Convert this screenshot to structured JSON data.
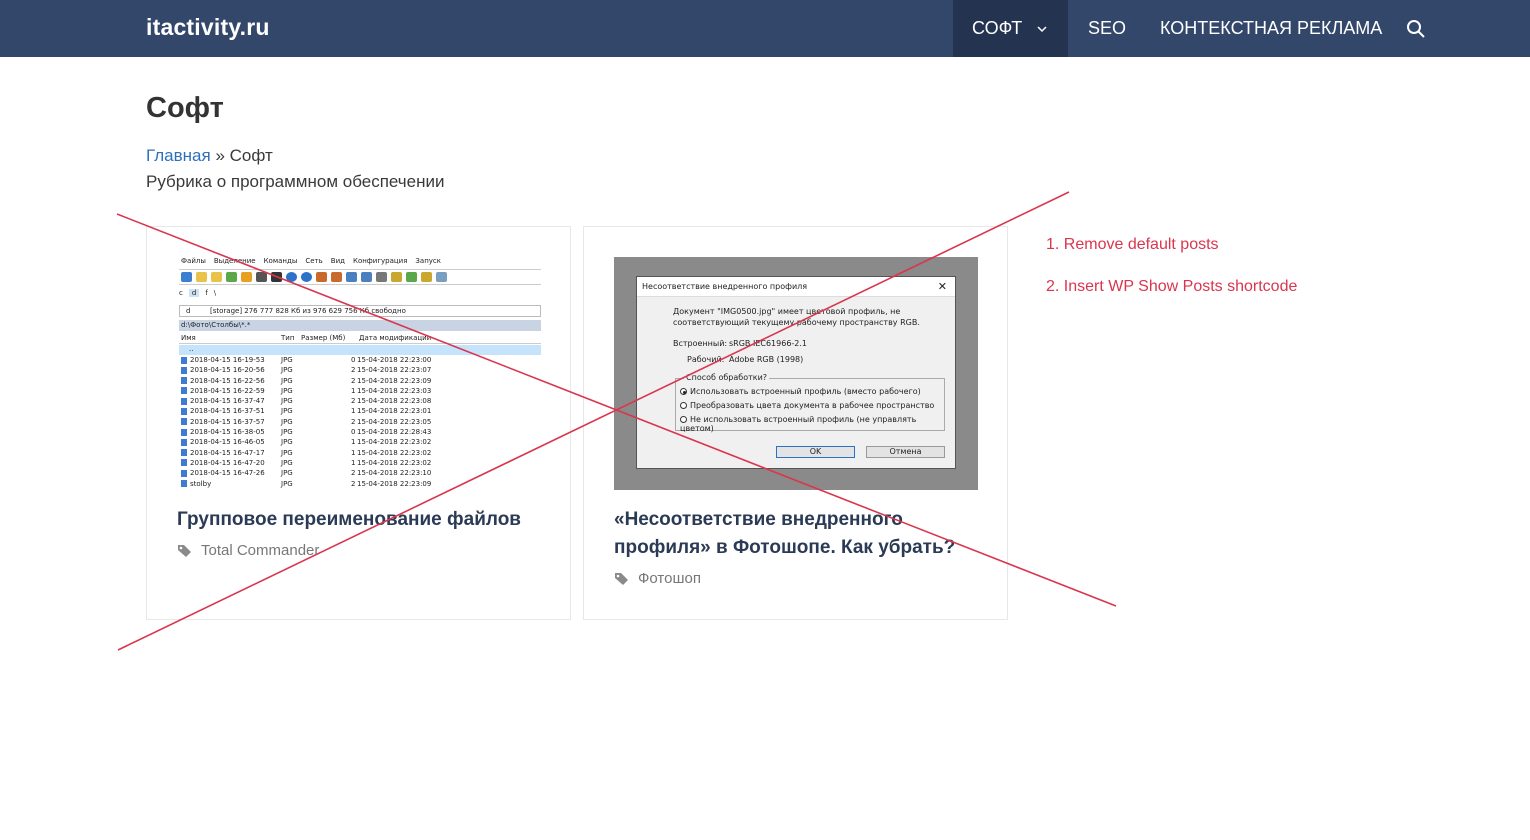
{
  "header": {
    "brand": "itactivity.ru",
    "nav": [
      {
        "label": "СОФТ",
        "active": true,
        "has_dropdown": true
      },
      {
        "label": "SEO"
      },
      {
        "label": "КОНТЕКСТНАЯ РЕКЛАМА"
      }
    ],
    "search_icon": "search-icon"
  },
  "page": {
    "title": "Софт",
    "breadcrumb": {
      "home": "Главная",
      "sep": " » ",
      "current": "Софт"
    },
    "description": "Рубрика о программном обеспечении"
  },
  "posts": [
    {
      "title": "Групповое переименование файлов",
      "tag": "Total Commander",
      "tag_icon": "tags-icon",
      "thumb": {
        "menu": [
          "Файлы",
          "Выделение",
          "Команды",
          "Сеть",
          "Вид",
          "Конфигурация",
          "Запуск"
        ],
        "drives": [
          "c",
          "d",
          "f",
          "\\"
        ],
        "drive_info": "[storage]  276 777 828 Кб из 976 629 756 Кб свободно",
        "drive_sel": "d",
        "path": "d:\\Фото\\Столбы\\*.*",
        "col_name": "Имя",
        "col_type": "Тип",
        "col_size": "Размер (Мб)",
        "col_date": "Дата модификации",
        "updir": "..",
        "files": [
          {
            "name": "2018-04-15 16-19-53",
            "type": "JPG",
            "size": "0",
            "date": "15-04-2018 22:23:00"
          },
          {
            "name": "2018-04-15 16-20-56",
            "type": "JPG",
            "size": "2",
            "date": "15-04-2018 22:23:07"
          },
          {
            "name": "2018-04-15 16-22-56",
            "type": "JPG",
            "size": "2",
            "date": "15-04-2018 22:23:09"
          },
          {
            "name": "2018-04-15 16-22-59",
            "type": "JPG",
            "size": "1",
            "date": "15-04-2018 22:23:03"
          },
          {
            "name": "2018-04-15 16-37-47",
            "type": "JPG",
            "size": "2",
            "date": "15-04-2018 22:23:08"
          },
          {
            "name": "2018-04-15 16-37-51",
            "type": "JPG",
            "size": "1",
            "date": "15-04-2018 22:23:01"
          },
          {
            "name": "2018-04-15 16-37-57",
            "type": "JPG",
            "size": "2",
            "date": "15-04-2018 22:23:05"
          },
          {
            "name": "2018-04-15 16-38-05",
            "type": "JPG",
            "size": "0",
            "date": "15-04-2018 22:28:43"
          },
          {
            "name": "2018-04-15 16-46-05",
            "type": "JPG",
            "size": "1",
            "date": "15-04-2018 22:23:02"
          },
          {
            "name": "2018-04-15 16-47-17",
            "type": "JPG",
            "size": "1",
            "date": "15-04-2018 22:23:02"
          },
          {
            "name": "2018-04-15 16-47-20",
            "type": "JPG",
            "size": "1",
            "date": "15-04-2018 22:23:02"
          },
          {
            "name": "2018-04-15 16-47-26",
            "type": "JPG",
            "size": "2",
            "date": "15-04-2018 22:23:10"
          },
          {
            "name": "stolby",
            "type": "JPG",
            "size": "2",
            "date": "15-04-2018 22:23:09"
          }
        ]
      }
    },
    {
      "title": "«Несоответствие внедренного профиля» в Фотошопе. Как убрать?",
      "tag": "Фотошоп",
      "tag_icon": "tags-icon",
      "thumb": {
        "dialog_title": "Несоответствие внедренного профиля",
        "close": "✕",
        "msg_line1": "Документ \"IMG0500.jpg\" имеет цветовой профиль, не",
        "msg_line2": "соответствующий текущему рабочему пространству RGB.",
        "embedded_label": "Встроенный:",
        "embedded_value": "sRGB IEC61966-2.1",
        "working_label": "Рабочий:",
        "working_value": "Adobe RGB (1998)",
        "group_label": "Способ обработки?",
        "options": [
          {
            "label": "Использовать встроенный профиль (вместо рабочего)",
            "selected": true
          },
          {
            "label": "Преобразовать цвета документа в рабочее пространство",
            "selected": false
          },
          {
            "label": "Не использовать встроенный профиль (не управлять цветом)",
            "selected": false
          }
        ],
        "ok": "OK",
        "cancel": "Отмена"
      }
    }
  ],
  "notes": [
    "1. Remove default posts",
    "2. Insert WP Show Posts shortcode"
  ],
  "colors": {
    "header_bg": "#33476b",
    "nav_active_bg": "#243450",
    "link": "#2f6fbb",
    "annotation": "#d9364e"
  }
}
